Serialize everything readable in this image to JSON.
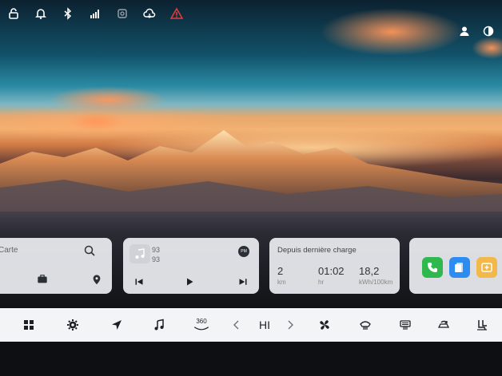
{
  "status_icons": [
    "lock-open-icon",
    "bell-icon",
    "bluetooth-icon",
    "signal-4g-icon",
    "camera-off-icon",
    "cloud-sync-icon",
    "warning-icon",
    "user-icon",
    "theme-icon"
  ],
  "colors": {
    "warning": "#e23b3b",
    "card": "#eceff3",
    "dock": "#f3f4f6",
    "phone_green": "#2fb84e",
    "blue_app": "#2d8cf0",
    "orange_app": "#f2b94a"
  },
  "map_widget": {
    "label": "Carte"
  },
  "music_widget": {
    "line1": "93",
    "line2": "93",
    "small": "PM"
  },
  "charge_widget": {
    "title": "Depuis dernière charge",
    "stats": [
      {
        "value": "2",
        "unit": "km"
      },
      {
        "value": "01:02",
        "unit": "hr"
      },
      {
        "value": "18,2",
        "unit": "kWh/100km"
      }
    ]
  },
  "dock": {
    "items": [
      "apps-grid-icon",
      "settings-icon",
      "navigation-icon",
      "music-note-icon",
      "camera-360-icon",
      "chevron-left-icon",
      "chevron-right-icon",
      "fan-icon",
      "defrost-front-icon",
      "defrost-rear-icon",
      "recirculation-icon",
      "seat-icon"
    ],
    "label_360": "360",
    "temperature": "HI"
  }
}
